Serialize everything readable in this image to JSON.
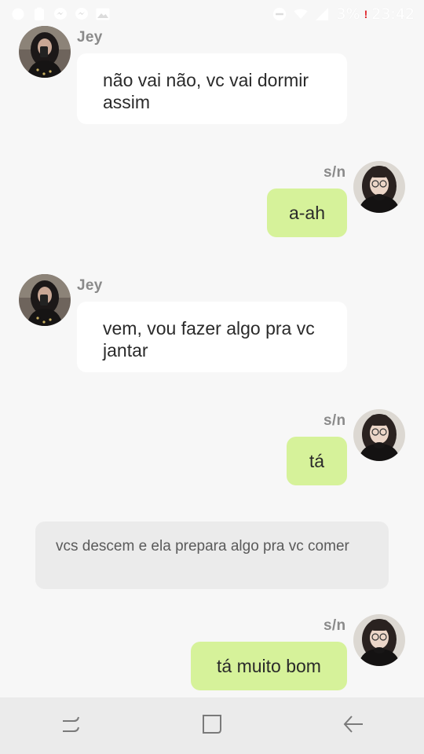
{
  "status_bar": {
    "battery_percent": "3%",
    "time": "23:42",
    "left_icons": [
      "whatsapp-icon",
      "clipboard-icon",
      "messenger-icon",
      "messenger-icon",
      "gallery-icon"
    ],
    "right_icons": [
      "do-not-disturb-icon",
      "wifi-icon",
      "signal-icon",
      "battery-alert-icon"
    ]
  },
  "chat": {
    "messages": [
      {
        "sender": "Jey",
        "side": "left",
        "text": "não vai não, vc vai dormir assim"
      },
      {
        "sender": "s/n",
        "side": "right",
        "text": "a-ah"
      },
      {
        "sender": "Jey",
        "side": "left",
        "text": "vem, vou fazer algo pra vc jantar"
      },
      {
        "sender": "s/n",
        "side": "right",
        "text": "tá"
      },
      {
        "sender": "",
        "side": "narration",
        "text": "vcs descem e ela prepara algo pra vc comer"
      },
      {
        "sender": "s/n",
        "side": "right",
        "text": "tá muito bom"
      }
    ]
  },
  "colors": {
    "background": "#f7f7f7",
    "incoming_bubble": "#ffffff",
    "outgoing_bubble": "#d6f29a",
    "narration_bubble": "#ebebeb",
    "name_text": "#8a8a8a",
    "nav_bar": "#ebebeb"
  },
  "nav_bar": {
    "buttons": [
      "recent-apps-icon",
      "home-icon",
      "back-icon"
    ]
  }
}
